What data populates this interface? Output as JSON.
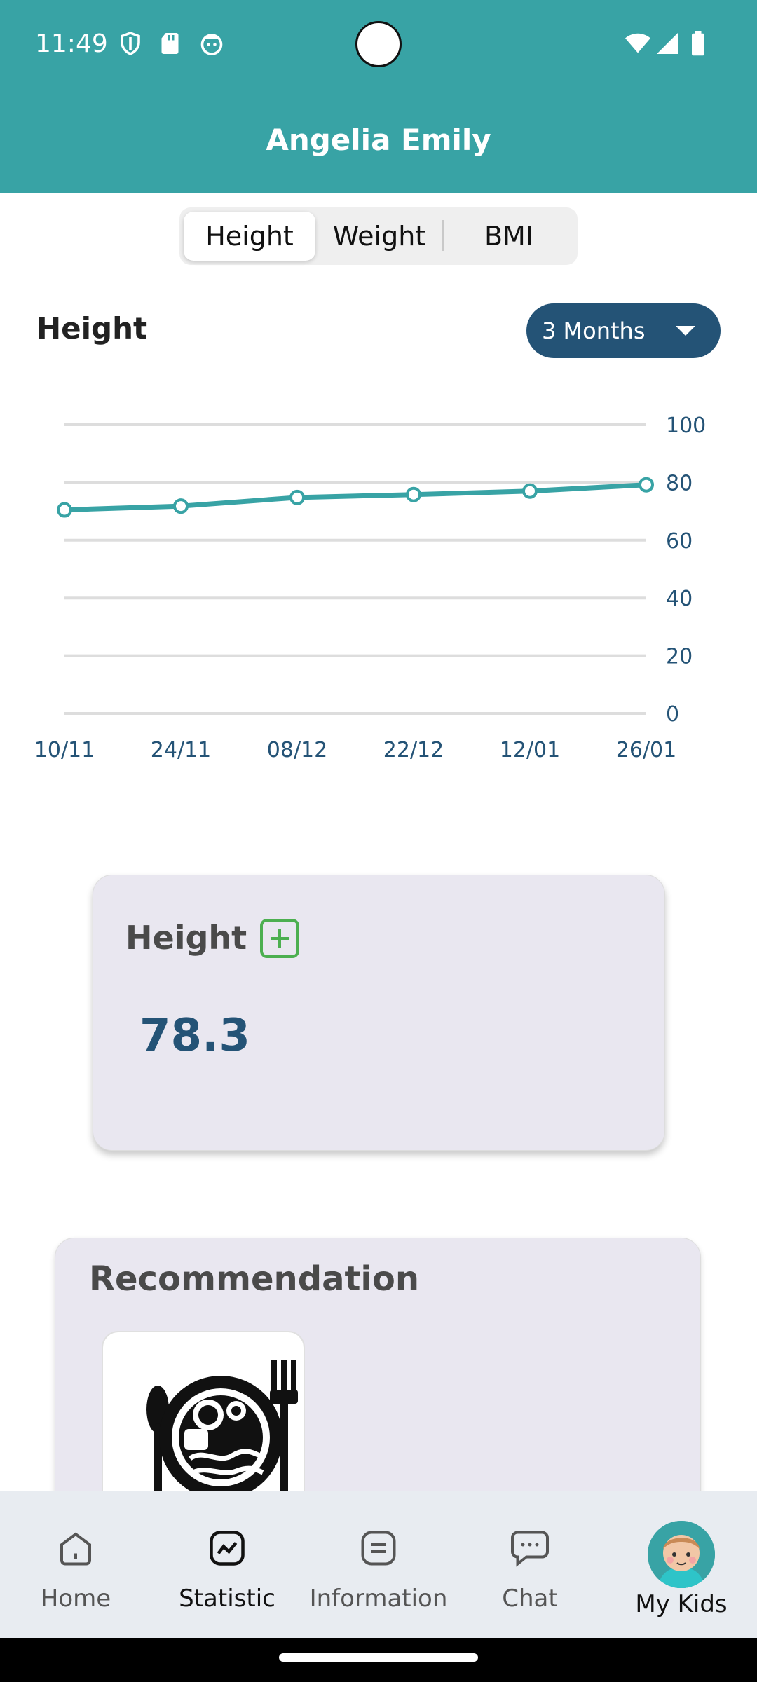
{
  "status_bar": {
    "time": "11:49"
  },
  "header": {
    "title": "Angelia Emily"
  },
  "tabs": [
    {
      "label": "Height",
      "active": true
    },
    {
      "label": "Weight",
      "active": false
    },
    {
      "label": "BMI",
      "active": false
    }
  ],
  "chart_section": {
    "title": "Height",
    "range_label": "3 Months"
  },
  "chart_data": {
    "type": "line",
    "x": [
      "10/11",
      "24/11",
      "08/12",
      "22/12",
      "12/01",
      "26/01"
    ],
    "y_ticks": [
      100,
      80,
      60,
      40,
      20,
      0
    ],
    "ylim": [
      0,
      100
    ],
    "series": [
      {
        "values": [
          70.5,
          71.8,
          74.8,
          75.8,
          77.0,
          79.2
        ],
        "color": "#38a3a5"
      }
    ]
  },
  "height_card": {
    "label": "Height",
    "value": "78.3"
  },
  "recommendation": {
    "title": "Recommendation"
  },
  "bottom_nav": [
    {
      "label": "Home",
      "icon": "home-icon",
      "active": false
    },
    {
      "label": "Statistic",
      "icon": "statistic-icon",
      "active": true
    },
    {
      "label": "Information",
      "icon": "information-icon",
      "active": false
    },
    {
      "label": "Chat",
      "icon": "chat-icon",
      "active": false
    },
    {
      "label": "My Kids",
      "icon": "kid-avatar",
      "active": false
    }
  ],
  "colors": {
    "teal": "#38a3a5",
    "navy": "#245376",
    "card_bg": "#e9e7f0"
  }
}
